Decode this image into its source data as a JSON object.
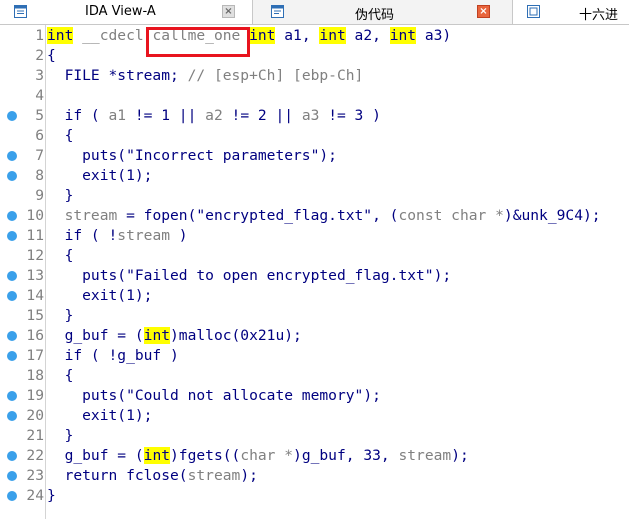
{
  "tabs": [
    {
      "label": "IDA View-A",
      "icon": "ida-view-icon",
      "close": "×"
    },
    {
      "label": "伪代码",
      "icon": "pseudocode-icon",
      "close": "×"
    },
    {
      "label": "十六进",
      "icon": "hex-view-icon"
    }
  ],
  "code": {
    "line_numbers": [
      "1",
      "2",
      "3",
      "4",
      "5",
      "6",
      "7",
      "8",
      "9",
      "10",
      "11",
      "12",
      "13",
      "14",
      "15",
      "16",
      "17",
      "18",
      "19",
      "20",
      "21",
      "22",
      "23",
      "24"
    ],
    "breakpoint_lines": [
      "5",
      "7",
      "8",
      "10",
      "11",
      "13",
      "14",
      "16",
      "17",
      "19",
      "20",
      "22",
      "23",
      "24"
    ],
    "lines": [
      [
        {
          "t": "int",
          "c": "kw"
        },
        {
          "t": " __cdecl ",
          "c": "gr"
        },
        {
          "t": "callme_one",
          "c": "gr"
        },
        {
          "t": " "
        },
        {
          "t": "int",
          "c": "kw"
        },
        {
          "t": " a1, "
        },
        {
          "t": "int",
          "c": "kw"
        },
        {
          "t": " a2, "
        },
        {
          "t": "int",
          "c": "kw"
        },
        {
          "t": " a3)"
        }
      ],
      [
        {
          "t": "{"
        }
      ],
      [
        {
          "t": "  FILE *stream; "
        },
        {
          "t": "// [esp+Ch] [ebp-Ch]",
          "c": "cm"
        }
      ],
      [],
      [
        {
          "t": "  if ( "
        },
        {
          "t": "a1",
          "c": "gr"
        },
        {
          "t": " != 1 || "
        },
        {
          "t": "a2",
          "c": "gr"
        },
        {
          "t": " != 2 || "
        },
        {
          "t": "a3",
          "c": "gr"
        },
        {
          "t": " != 3 )"
        }
      ],
      [
        {
          "t": "  {"
        }
      ],
      [
        {
          "t": "    puts("
        },
        {
          "t": "\"Incorrect parameters\"",
          "c": "str"
        },
        {
          "t": ");"
        }
      ],
      [
        {
          "t": "    exit(1);"
        }
      ],
      [
        {
          "t": "  }"
        }
      ],
      [
        {
          "t": "  "
        },
        {
          "t": "stream",
          "c": "gr"
        },
        {
          "t": " = fopen("
        },
        {
          "t": "\"encrypted_flag.txt\"",
          "c": "str"
        },
        {
          "t": ", ("
        },
        {
          "t": "const char *",
          "c": "gr"
        },
        {
          "t": ")&unk_9C4);"
        }
      ],
      [
        {
          "t": "  if ( !"
        },
        {
          "t": "stream",
          "c": "gr"
        },
        {
          "t": " )"
        }
      ],
      [
        {
          "t": "  {"
        }
      ],
      [
        {
          "t": "    puts("
        },
        {
          "t": "\"Failed to open encrypted_flag.txt\"",
          "c": "str"
        },
        {
          "t": ");"
        }
      ],
      [
        {
          "t": "    exit(1);"
        }
      ],
      [
        {
          "t": "  }"
        }
      ],
      [
        {
          "t": "  g_buf = ("
        },
        {
          "t": "int",
          "c": "kw"
        },
        {
          "t": ")malloc(0x21u);"
        }
      ],
      [
        {
          "t": "  if ( !g_buf )"
        }
      ],
      [
        {
          "t": "  {"
        }
      ],
      [
        {
          "t": "    puts("
        },
        {
          "t": "\"Could not allocate memory\"",
          "c": "str"
        },
        {
          "t": ");"
        }
      ],
      [
        {
          "t": "    exit(1);"
        }
      ],
      [
        {
          "t": "  }"
        }
      ],
      [
        {
          "t": "  g_buf = ("
        },
        {
          "t": "int",
          "c": "kw"
        },
        {
          "t": ")fgets(("
        },
        {
          "t": "char *",
          "c": "gr"
        },
        {
          "t": ")g_buf, 33, "
        },
        {
          "t": "stream",
          "c": "gr"
        },
        {
          "t": ");"
        }
      ],
      [
        {
          "t": "  return fclose("
        },
        {
          "t": "stream",
          "c": "gr"
        },
        {
          "t": ");"
        }
      ],
      [
        {
          "t": "}"
        }
      ]
    ]
  },
  "colors": {
    "keyword_highlight": "#ffff00",
    "code_text": "#000080",
    "grey_text": "#808080",
    "breakpoint_dot": "#3aa0ea",
    "annotation_box": "#e8141e",
    "active_close": "#e8643c"
  }
}
